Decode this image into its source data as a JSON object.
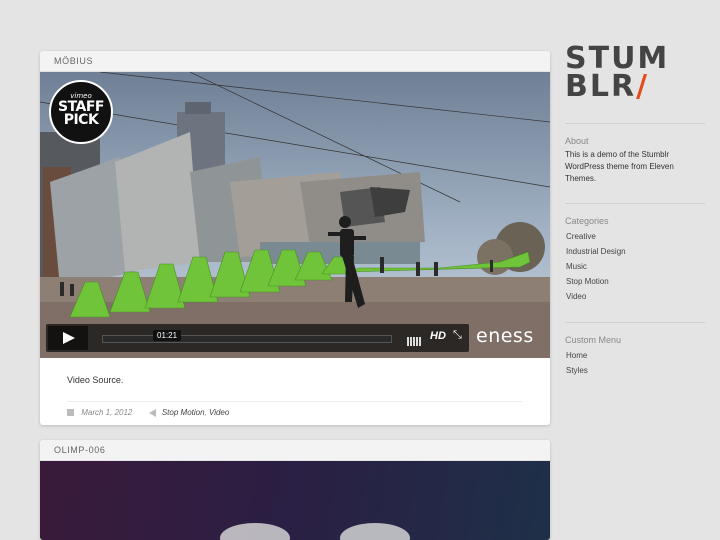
{
  "posts": [
    {
      "title": "MÖBIUS",
      "video": {
        "badge_top": "vimeo",
        "badge_line1": "STAFF",
        "badge_line2": "PICK",
        "timecode": "01:21",
        "hd_label": "HD",
        "brand": "eness",
        "progress": 0.0
      },
      "text": "Video Source.",
      "date": "March 1, 2012",
      "tags": [
        "Stop Motion",
        "Video"
      ]
    },
    {
      "title": "OLIMP-006"
    }
  ],
  "sidebar": {
    "logo_line1": "STUM",
    "logo_line2": "BLR",
    "logo_slash": "/",
    "about_title": "About",
    "about_text": "This is a demo of the Stumblr WordPress theme from Eleven Themes.",
    "categories_title": "Categories",
    "categories": [
      "Creative",
      "Industrial Design",
      "Music",
      "Stop Motion",
      "Video"
    ],
    "menu_title": "Custom Menu",
    "menu": [
      "Home",
      "Styles"
    ]
  },
  "colors": {
    "background": "#e4e4e4",
    "accent": "#e24d1f",
    "installation_green": "#6fc43a"
  }
}
